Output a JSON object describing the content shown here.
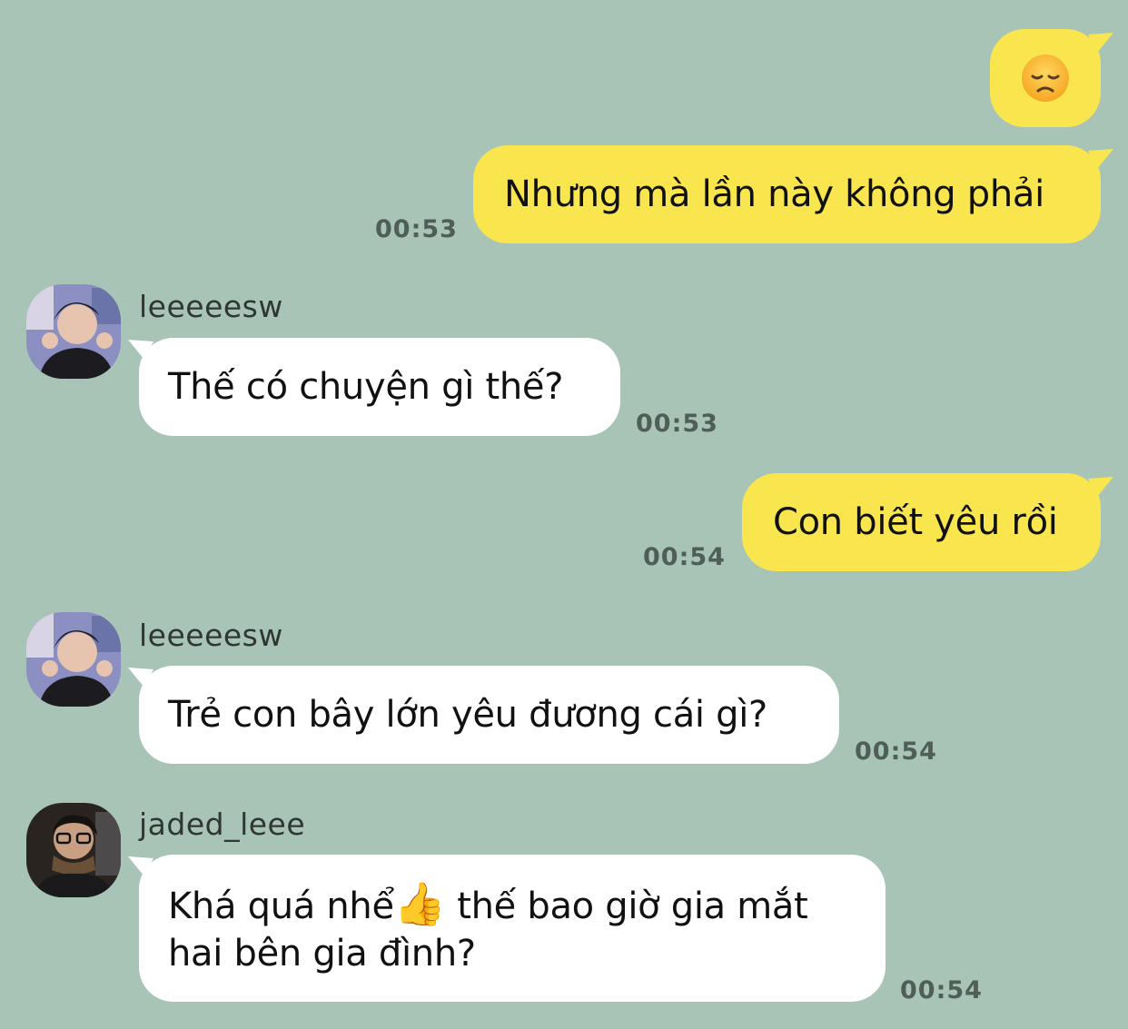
{
  "messages": {
    "m1": {
      "emoji": "😞",
      "emoji_name": "disappointed-face"
    },
    "m2": {
      "text": "Nhưng mà lần này không phải",
      "time": "00:53"
    },
    "m3": {
      "sender": "leeeeesw",
      "text": "Thế có chuyện gì thế?",
      "time": "00:53"
    },
    "m4": {
      "text": "Con biết yêu rồi",
      "time": "00:54"
    },
    "m5": {
      "sender": "leeeeesw",
      "text": "Trẻ con bây lớn yêu đương cái gì?",
      "time": "00:54"
    },
    "m6": {
      "sender": "jaded_leee",
      "text_line1_a": "Khá quá nhể",
      "emoji": "👍",
      "text_line1_b": " thế bao giờ gia mắt",
      "text_line2": "hai bên gia đình?",
      "time": "00:54"
    }
  },
  "colors": {
    "background": "#a7c4b7",
    "outgoing_bubble": "#f9e54e",
    "incoming_bubble": "#ffffff",
    "timestamp": "#4f5e57"
  }
}
